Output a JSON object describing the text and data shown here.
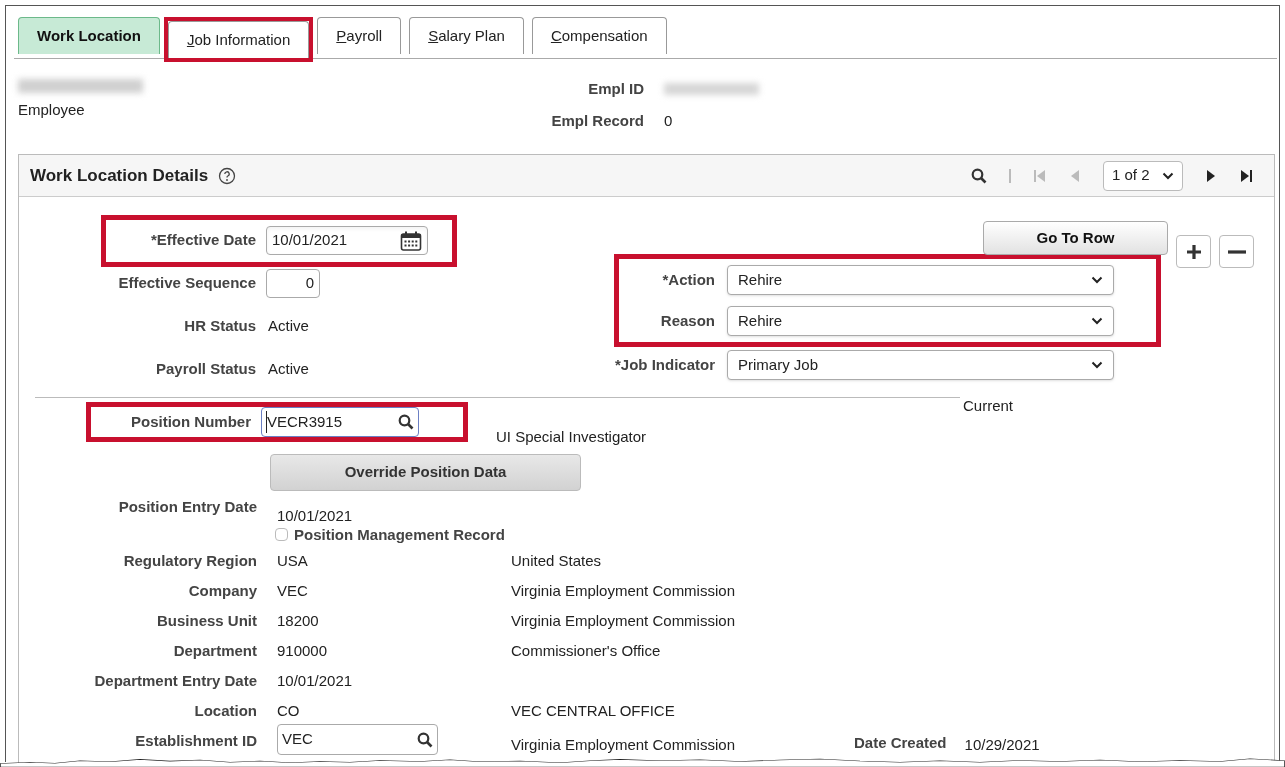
{
  "tabs": [
    {
      "rest": "Work Location",
      "selected": true,
      "highlighted": false
    },
    {
      "key": "J",
      "rest": "ob Information",
      "selected": false,
      "highlighted": true
    },
    {
      "key": "P",
      "rest": "ayroll",
      "selected": false,
      "highlighted": false
    },
    {
      "key": "S",
      "rest": "alary Plan",
      "selected": false,
      "highlighted": false
    },
    {
      "key": "C",
      "rest": "ompensation",
      "selected": false,
      "highlighted": false
    }
  ],
  "employee": {
    "role": "Employee"
  },
  "ids": [
    {
      "label": "Empl ID"
    },
    {
      "label": "Empl Record",
      "value": "0"
    }
  ],
  "panel": {
    "title": "Work Location Details",
    "pager": "1 of 2",
    "go_to_row": "Go To Row"
  },
  "top_left": [
    {
      "label": "*Effective Date",
      "kind": "date",
      "value": "10/01/2021",
      "highlighted": true
    },
    {
      "label": "Effective Sequence",
      "kind": "number",
      "value": "0",
      "highlighted": false
    },
    {
      "label": "HR Status",
      "kind": "text",
      "value": "Active",
      "highlighted": false
    },
    {
      "label": "Payroll Status",
      "kind": "text",
      "value": "Active",
      "highlighted": false
    }
  ],
  "top_right": [
    {
      "highlighted": true,
      "fields": [
        {
          "label": "*Action",
          "value": "Rehire"
        },
        {
          "label": "Reason",
          "value": "Rehire"
        }
      ]
    },
    {
      "highlighted": false,
      "fields": [
        {
          "label": "*Job Indicator",
          "value": "Primary Job"
        }
      ]
    }
  ],
  "current_label": "Current",
  "position": {
    "label": "Position Number",
    "value": "VECR3915",
    "highlighted": true,
    "description": "UI Special Investigator",
    "override_button": "Override Position Data",
    "entry_label": "Position Entry Date",
    "entry_value": "10/01/2021",
    "management": {
      "label": "Position Management Record",
      "checked": false
    }
  },
  "details": [
    {
      "label": "Regulatory Region",
      "kind": "text",
      "value": "USA",
      "description": "United States"
    },
    {
      "label": "Company",
      "kind": "text",
      "value": "VEC",
      "description": "Virginia Employment Commission"
    },
    {
      "label": "Business Unit",
      "kind": "text",
      "value": "18200",
      "description": "Virginia Employment Commission"
    },
    {
      "label": "Department",
      "kind": "text",
      "value": "910000",
      "description": "Commissioner's Office"
    },
    {
      "label": "Department Entry Date",
      "kind": "text",
      "value": "10/01/2021"
    },
    {
      "label": "Location",
      "kind": "text",
      "value": "CO",
      "description": "VEC CENTRAL OFFICE"
    },
    {
      "label": "Establishment ID",
      "kind": "lookup",
      "value": "VEC",
      "description": "Virginia Employment Commission",
      "extra_label": "Date Created",
      "extra_value": "10/29/2021"
    }
  ]
}
